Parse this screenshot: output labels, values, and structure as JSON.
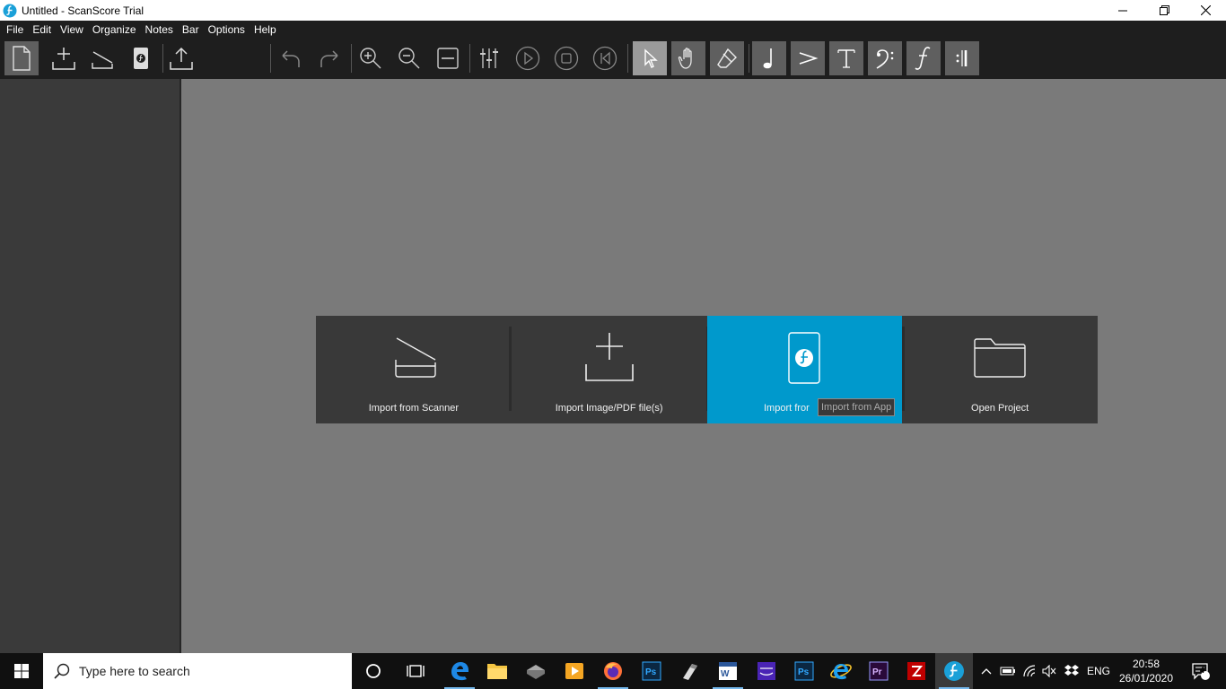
{
  "window": {
    "title": "Untitled - ScanScore Trial"
  },
  "menu": [
    "File",
    "Edit",
    "View",
    "Organize",
    "Notes",
    "Bar",
    "Options",
    "Help"
  ],
  "import_options": [
    {
      "label": "Import from Scanner",
      "icon": "scanner-icon"
    },
    {
      "label": "Import Image/PDF file(s)",
      "icon": "import-file-icon"
    },
    {
      "label": "Import from App",
      "icon": "app-phone-icon",
      "visible_label": "Import fror"
    },
    {
      "label": "Open Project",
      "icon": "folder-icon"
    }
  ],
  "tooltip": "Import from App",
  "taskbar": {
    "search_placeholder": "Type here to search",
    "language": "ENG",
    "time": "20:58",
    "date": "26/01/2020",
    "notifications": "4"
  },
  "colors": {
    "accent": "#0099cc",
    "toolbar": "#1e1e1e",
    "sidebar": "#3a3a3a",
    "canvas": "#7a7a7a"
  }
}
